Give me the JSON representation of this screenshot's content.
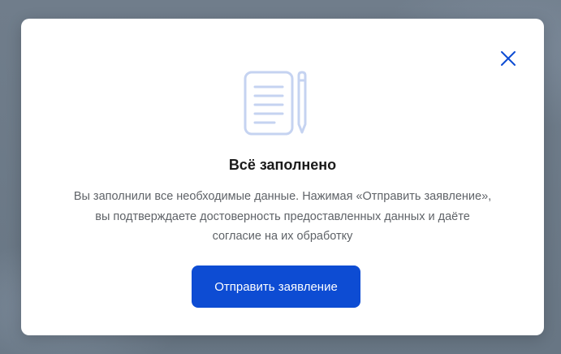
{
  "dialog": {
    "close_icon": "close-icon",
    "illustration_icon": "document-pencil-icon",
    "title": "Всё заполнено",
    "description_lines": [
      "Вы заполнили все необходимые данные. Нажимая «Отправить заявление»,",
      "вы подтверждаете достоверность предоставленных данных и даёте",
      "согласие на их обработку"
    ],
    "submit_label": "Отправить заявление"
  },
  "colors": {
    "primary": "#0d4cd3",
    "illustration": "#c5d3f1",
    "overlay": "#6c7988"
  }
}
